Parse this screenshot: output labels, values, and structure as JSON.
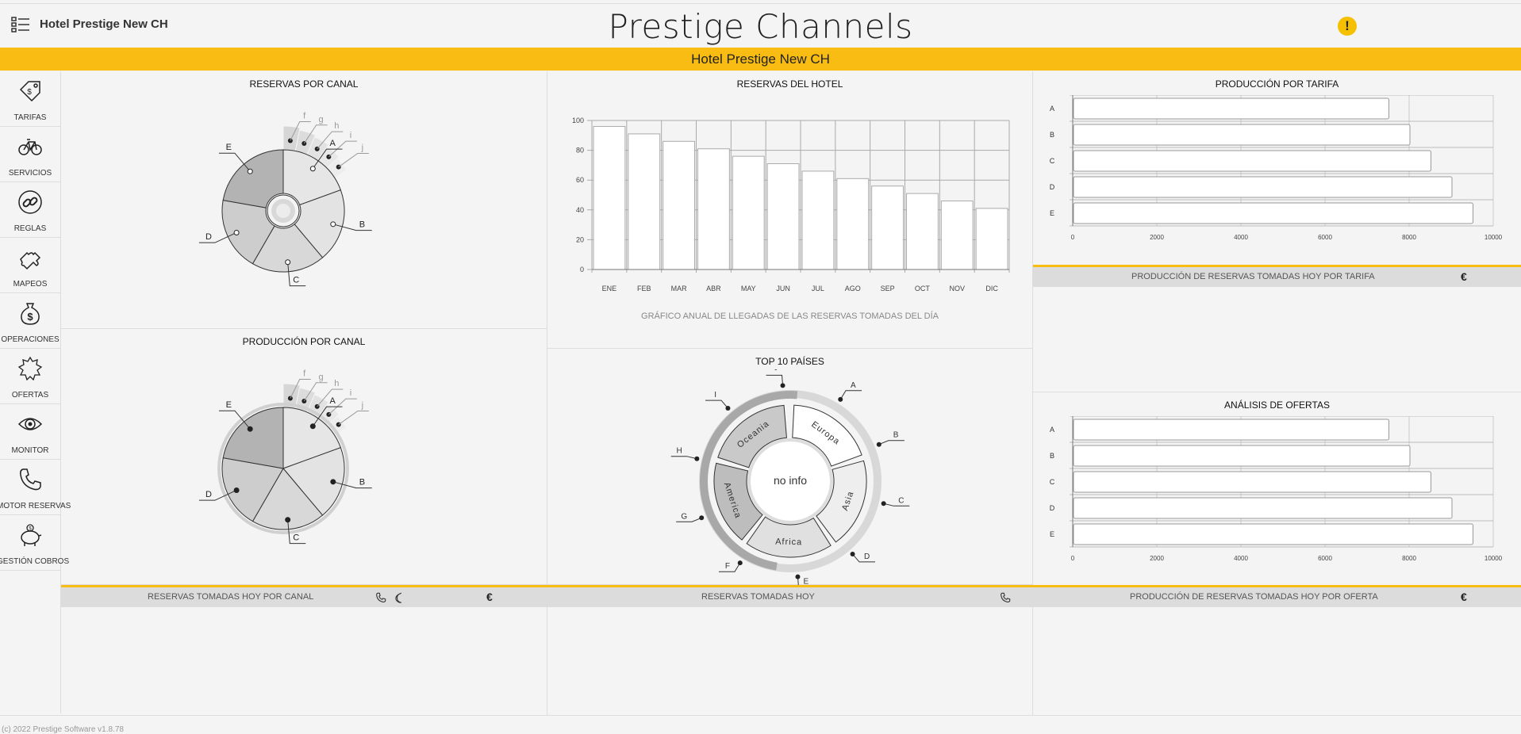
{
  "header": {
    "hotel_name": "Hotel Prestige New CH",
    "app_title": "Prestige Channels",
    "banner": "Hotel Prestige New CH"
  },
  "sidebar": {
    "items": [
      {
        "label": "TARIFAS",
        "icon": "price-tag-icon"
      },
      {
        "label": "SERVICIOS",
        "icon": "bicycle-icon"
      },
      {
        "label": "REGLAS",
        "icon": "link-icon"
      },
      {
        "label": "MAPEOS",
        "icon": "puzzle-icon"
      },
      {
        "label": "OPERACIONES",
        "icon": "money-bag-icon"
      },
      {
        "label": "OFERTAS",
        "icon": "badge-icon"
      },
      {
        "label": "MONITOR",
        "icon": "eye-icon"
      },
      {
        "label": "MOTOR RESERVAS",
        "icon": "phone-icon"
      },
      {
        "label": "GESTIÓN COBROS",
        "icon": "piggy-bank-icon"
      }
    ]
  },
  "panels": {
    "reservas_canal": {
      "title": "RESERVAS POR CANAL"
    },
    "produccion_canal": {
      "title": "PRODUCCIÓN POR CANAL"
    },
    "reservas_hotel": {
      "title": "RESERVAS DEL HOTEL",
      "caption": "GRÁFICO ANUAL DE LLEGADAS DE LAS RESERVAS TOMADAS DEL DÍA"
    },
    "top_paises": {
      "title": "TOP 10 PAÍSES",
      "center": "no info"
    },
    "produccion_tarifa": {
      "title": "PRODUCCIÓN POR TARIFA"
    },
    "analisis_ofertas": {
      "title": "ANÁLISIS DE OFERTAS"
    }
  },
  "footers": {
    "canal": "RESERVAS TOMADAS HOY POR CANAL",
    "hoy": "RESERVAS TOMADAS HOY",
    "tarifa": "PRODUCCIÓN DE RESERVAS TOMADAS HOY POR TARIFA",
    "oferta": "PRODUCCIÓN DE RESERVAS TOMADAS HOY POR OFERTA",
    "currency": "€"
  },
  "copyright": "(c) 2022 Prestige Software v1.8.78",
  "colors": {
    "accent": "#f8bc12"
  },
  "chart_data": [
    {
      "id": "reservas_canal",
      "type": "pie",
      "title": "RESERVAS POR CANAL",
      "labels": [
        "A",
        "B",
        "C",
        "D",
        "E",
        "f",
        "g",
        "h",
        "i",
        "j"
      ],
      "values": [
        14,
        14,
        14,
        14,
        16,
        0,
        0,
        0,
        0,
        0
      ]
    },
    {
      "id": "produccion_canal",
      "type": "pie",
      "title": "PRODUCCIÓN POR CANAL",
      "labels": [
        "A",
        "B",
        "C",
        "D",
        "E",
        "f",
        "g",
        "h",
        "i",
        "j"
      ],
      "values": [
        14,
        14,
        14,
        14,
        16,
        0,
        0,
        0,
        0,
        0
      ]
    },
    {
      "id": "reservas_hotel",
      "type": "bar",
      "title": "RESERVAS DEL HOTEL",
      "categories": [
        "ENE",
        "FEB",
        "MAR",
        "ABR",
        "MAY",
        "JUN",
        "JUL",
        "AGO",
        "SEP",
        "OCT",
        "NOV",
        "DIC"
      ],
      "values": [
        96,
        91,
        86,
        81,
        76,
        71,
        66,
        61,
        56,
        51,
        46,
        41
      ],
      "ylim": [
        0,
        100
      ],
      "yticks": [
        0,
        20,
        40,
        60,
        80,
        100
      ],
      "grid": true
    },
    {
      "id": "top_paises",
      "type": "pie",
      "title": "TOP 10 PAÍSES",
      "inner_labels": [
        "Europa",
        "Asia",
        "Africa",
        "America",
        "Oceania"
      ],
      "labels": [
        "A",
        "B",
        "C",
        "D",
        "E",
        "F",
        "G",
        "H",
        "I",
        "-"
      ]
    },
    {
      "id": "produccion_tarifa",
      "type": "bar",
      "orientation": "horizontal",
      "title": "PRODUCCIÓN POR TARIFA",
      "categories": [
        "A",
        "B",
        "C",
        "D",
        "E"
      ],
      "values": [
        7500,
        8000,
        8500,
        9000,
        9500
      ],
      "xlim": [
        0,
        10000
      ],
      "xticks": [
        0,
        2000,
        4000,
        6000,
        8000,
        10000
      ]
    },
    {
      "id": "analisis_ofertas",
      "type": "bar",
      "orientation": "horizontal",
      "title": "ANÁLISIS DE OFERTAS",
      "categories": [
        "A",
        "B",
        "C",
        "D",
        "E"
      ],
      "values": [
        7500,
        8000,
        8500,
        9000,
        9500
      ],
      "xlim": [
        0,
        10000
      ],
      "xticks": [
        0,
        2000,
        4000,
        6000,
        8000,
        10000
      ]
    }
  ]
}
